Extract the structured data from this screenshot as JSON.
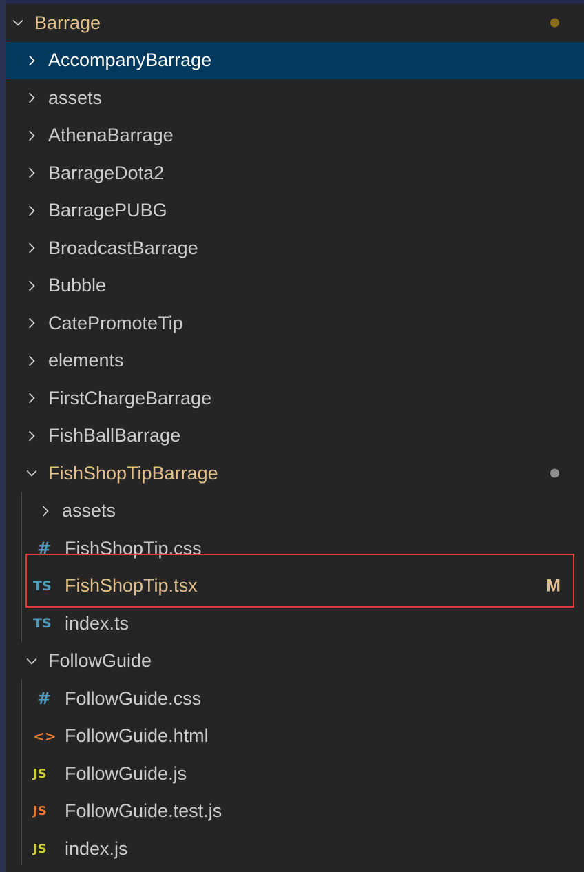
{
  "explorer": {
    "root": {
      "label": "Barrage",
      "expanded": true,
      "status_dot": true
    },
    "folders": [
      {
        "label": "AccompanyBarrage",
        "selected": true
      },
      {
        "label": "assets"
      },
      {
        "label": "AthenaBarrage"
      },
      {
        "label": "BarrageDota2"
      },
      {
        "label": "BarragePUBG"
      },
      {
        "label": "BroadcastBarrage"
      },
      {
        "label": "Bubble"
      },
      {
        "label": "CatePromoteTip"
      },
      {
        "label": "elements"
      },
      {
        "label": "FirstChargeBarrage"
      },
      {
        "label": "FishBallBarrage"
      }
    ],
    "fishshop": {
      "label": "FishShopTipBarrage",
      "expanded": true,
      "status_dot": true,
      "children": {
        "assets": "assets",
        "css": {
          "icon": "#",
          "label": "FishShopTip.css"
        },
        "tsx": {
          "icon": "TS",
          "label": "FishShopTip.tsx",
          "badge": "M"
        },
        "index": {
          "icon": "TS",
          "label": "index.ts"
        }
      }
    },
    "followguide": {
      "label": "FollowGuide",
      "expanded": true,
      "children": {
        "css": {
          "icon": "#",
          "label": "FollowGuide.css"
        },
        "html": {
          "icon": "<>",
          "label": "FollowGuide.html"
        },
        "js": {
          "icon": "JS",
          "label": "FollowGuide.js"
        },
        "test": {
          "icon": "JS",
          "label": "FollowGuide.test.js"
        },
        "index": {
          "icon": "JS",
          "label": "index.js"
        }
      }
    },
    "colors": {
      "background": "#252526",
      "selected": "#04395e",
      "modified": "#e2c08d",
      "highlight_box": "#e03b3b"
    }
  }
}
